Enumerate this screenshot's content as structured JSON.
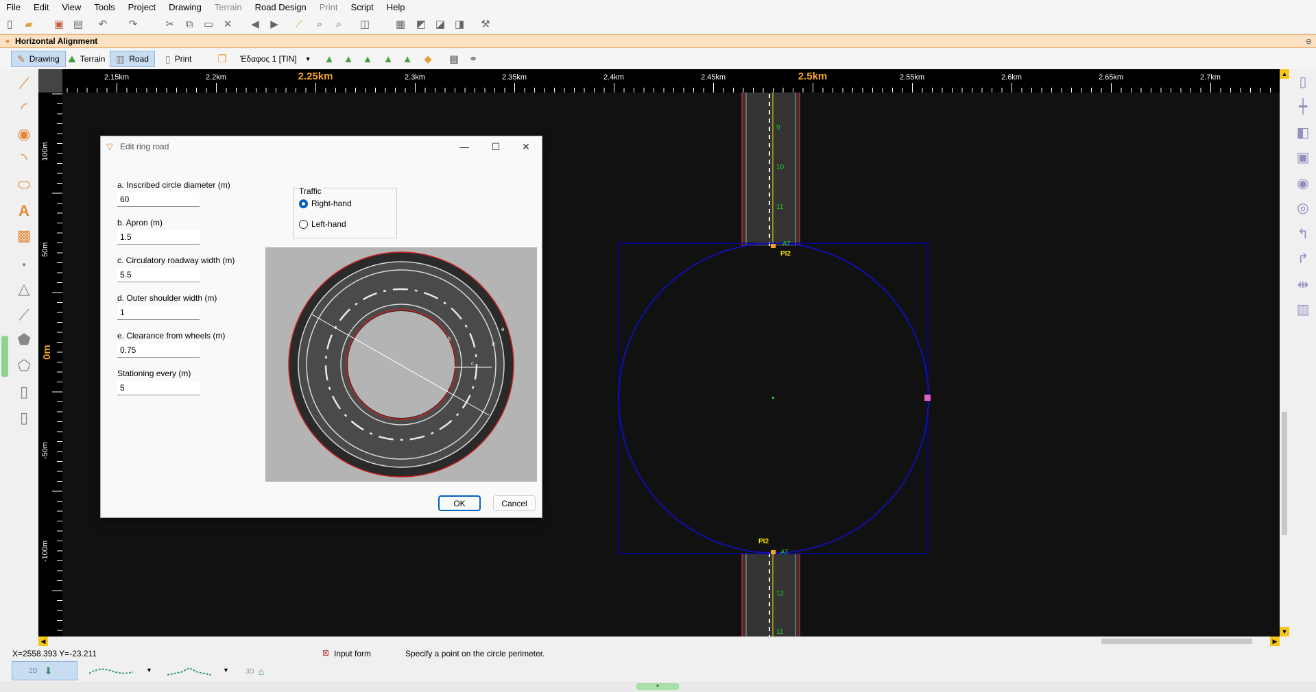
{
  "menu": [
    "File",
    "Edit",
    "View",
    "Tools",
    "Project",
    "Drawing",
    "Terrain",
    "Road Design",
    "Print",
    "Script",
    "Help"
  ],
  "menu_disabled": [
    "Terrain",
    "Print"
  ],
  "panel": {
    "title": "Horizontal Alignment"
  },
  "tabs": {
    "drawing": "Drawing",
    "terrain": "Terrain",
    "road": "Road",
    "print": "Print"
  },
  "surface_select": "Έδαφος 1 [TIN]",
  "ruler": {
    "h_labels": [
      "2.15km",
      "2.2km",
      "2.25km",
      "2.3km",
      "2.35km",
      "2.4km",
      "2.45km",
      "2.5km",
      "2.55km",
      "2.6km",
      "2.65km",
      "2.7km"
    ],
    "h_major": [
      "2.25km",
      "2.5km"
    ],
    "v_labels": [
      "100m",
      "50m",
      "0m",
      "-50m",
      "-100m"
    ],
    "v_major": [
      "0m"
    ]
  },
  "drawing": {
    "station_labels_top": [
      "8",
      "9",
      "10",
      "11"
    ],
    "station_labels_bottom": [
      "12",
      "11"
    ],
    "pi_top": "PI2",
    "at_top": "AT",
    "pi_bottom": "PI2",
    "at_bottom": "AT"
  },
  "dialog": {
    "title": "Edit ring road",
    "fields": [
      {
        "label": "a. Inscribed circle diameter (m)",
        "value": "60"
      },
      {
        "label": "b. Apron (m)",
        "value": "1.5"
      },
      {
        "label": "c. Circulatory roadway width (m)",
        "value": "5.5"
      },
      {
        "label": "d. Outer shoulder width (m)",
        "value": "1"
      },
      {
        "label": "e. Clearance from wheels (m)",
        "value": "0.75"
      },
      {
        "label": "Stationing every (m)",
        "value": "5"
      }
    ],
    "traffic": {
      "title": "Traffic",
      "options": [
        "Right-hand",
        "Left-hand"
      ],
      "selected": "Right-hand"
    },
    "preview_markers": [
      "b",
      "c",
      "d",
      "e"
    ],
    "ok": "OK",
    "cancel": "Cancel"
  },
  "status": {
    "coords": "X=2558.393  Y=-23.211",
    "input_form": "Input form",
    "prompt": "Specify a point on the circle perimeter."
  },
  "bottom_tabs": [
    "2D",
    "3D"
  ],
  "colors": {
    "accent": "#f5a623",
    "selection_blue": "#0000a0",
    "station_green": "#22cc22",
    "pi_yellow": "#f5e000"
  }
}
